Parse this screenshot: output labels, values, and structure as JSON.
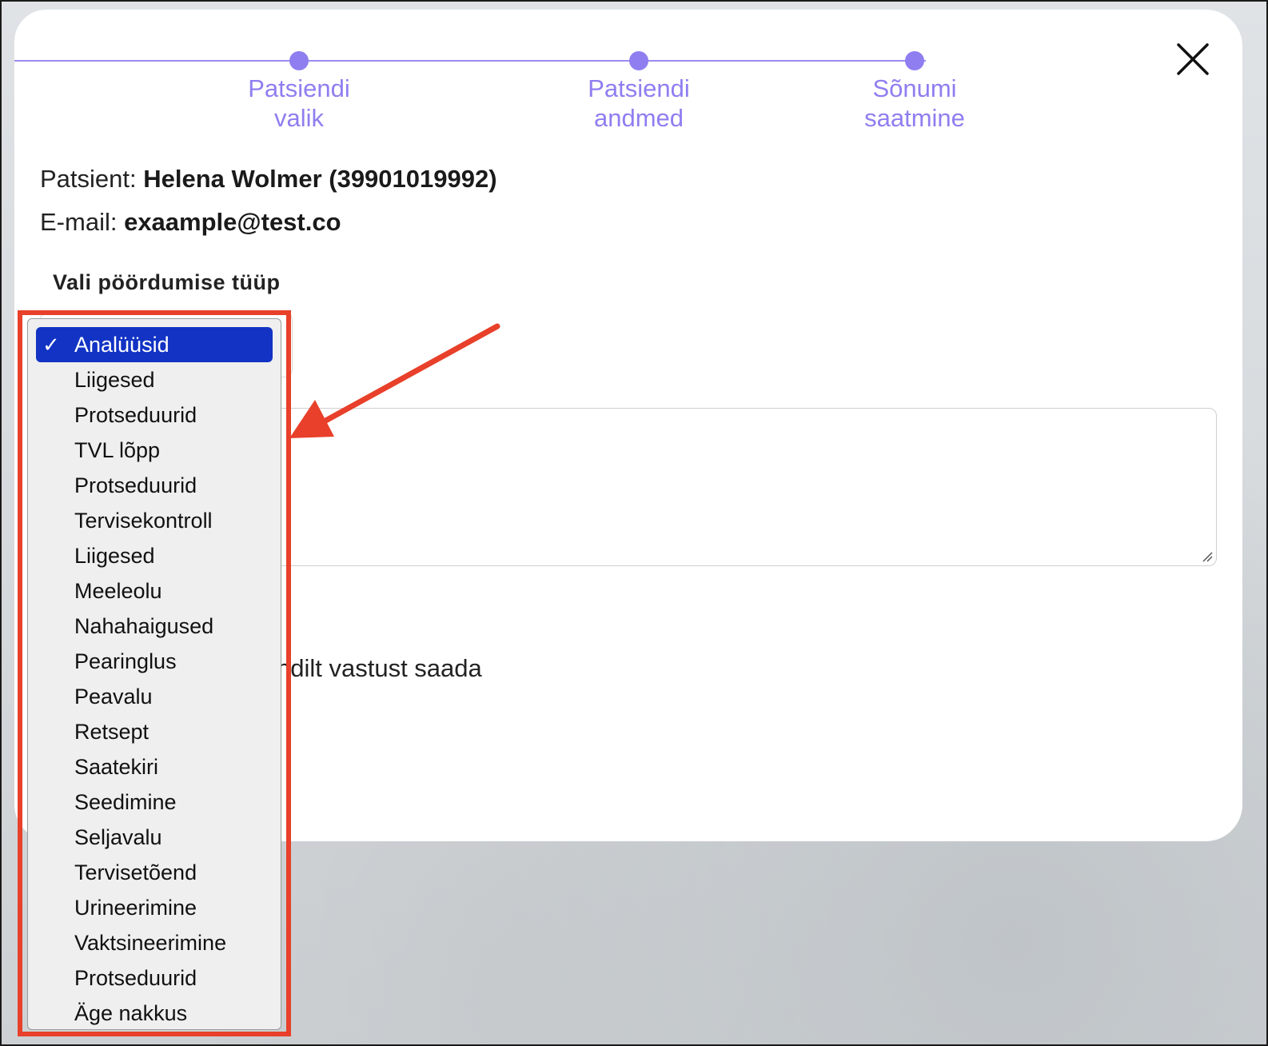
{
  "stepper": {
    "steps": [
      {
        "label": "Patsiendi\nvalik"
      },
      {
        "label": "Patsiendi\nandmed"
      },
      {
        "label": "Sõnumi\nsaatmine"
      }
    ],
    "color": "#8f7ef0"
  },
  "close_icon": "close-icon",
  "patient": {
    "label": "Patsient:",
    "value": "Helena Wolmer (39901019992)"
  },
  "email": {
    "label": "E-mail:",
    "value": "exaample@test.co"
  },
  "type_select": {
    "label": "Vali pöördumise tüüp",
    "options": [
      {
        "label": "Analüüsid",
        "selected": true
      },
      {
        "label": "Liigesed"
      },
      {
        "label": "Protseduurid"
      },
      {
        "label": "TVL lõpp"
      },
      {
        "label": "Protseduurid"
      },
      {
        "label": "Tervisekontroll"
      },
      {
        "label": "Liigesed"
      },
      {
        "label": "Meeleolu"
      },
      {
        "label": "Nahahaigused"
      },
      {
        "label": "Pearinglus"
      },
      {
        "label": "Peavalu"
      },
      {
        "label": "Retsept"
      },
      {
        "label": "Saatekiri"
      },
      {
        "label": "Seedimine"
      },
      {
        "label": "Seljavalu"
      },
      {
        "label": "Tervisetõend"
      },
      {
        "label": "Urineerimine"
      },
      {
        "label": "Vaktsineerimine"
      },
      {
        "label": "Protseduurid"
      },
      {
        "label": "Äge nakkus"
      }
    ],
    "check_mark": "✓",
    "selected_color": "#1233c4"
  },
  "reply_option": {
    "partial_label": "ndilt vastust saada"
  },
  "annotation": {
    "color": "#e8402a"
  }
}
